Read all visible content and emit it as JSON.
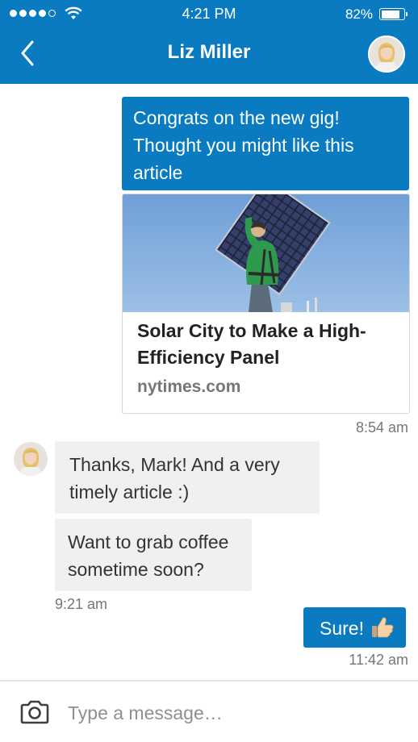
{
  "status_bar": {
    "time": "4:21 PM",
    "battery": "82%",
    "battery_level": 0.82,
    "signal_bars_filled": 4,
    "signal_bars_total": 5
  },
  "header": {
    "back_icon": "chevron-left-icon",
    "title": "Liz Miller",
    "avatar_icon": "contact-avatar"
  },
  "messages": [
    {
      "direction": "outgoing",
      "lines": [
        "Congrats on the new gig!",
        "Thought you might like this",
        "article"
      ]
    },
    {
      "direction": "outgoing",
      "type": "article",
      "title_lines": [
        "Solar City to Make a High-",
        "Efficiency Panel"
      ],
      "source": "nytimes.com",
      "time": "8:54 am"
    },
    {
      "direction": "incoming",
      "lines": [
        "Thanks, Mark! And a very",
        "timely article :)"
      ]
    },
    {
      "direction": "incoming",
      "lines": [
        "Want to grab coffee",
        "sometime soon?"
      ],
      "time": "9:21 am"
    },
    {
      "direction": "outgoing",
      "text": "Sure!",
      "emoji_icon": "thumbs-up-icon",
      "time": "11:42 am"
    }
  ],
  "composer": {
    "placeholder": "Type a message…",
    "value": "",
    "camera_icon": "camera-icon"
  },
  "colors": {
    "brand": "#0a7bc1",
    "incoming_bubble": "#eef0f2",
    "muted_text": "#747679"
  }
}
